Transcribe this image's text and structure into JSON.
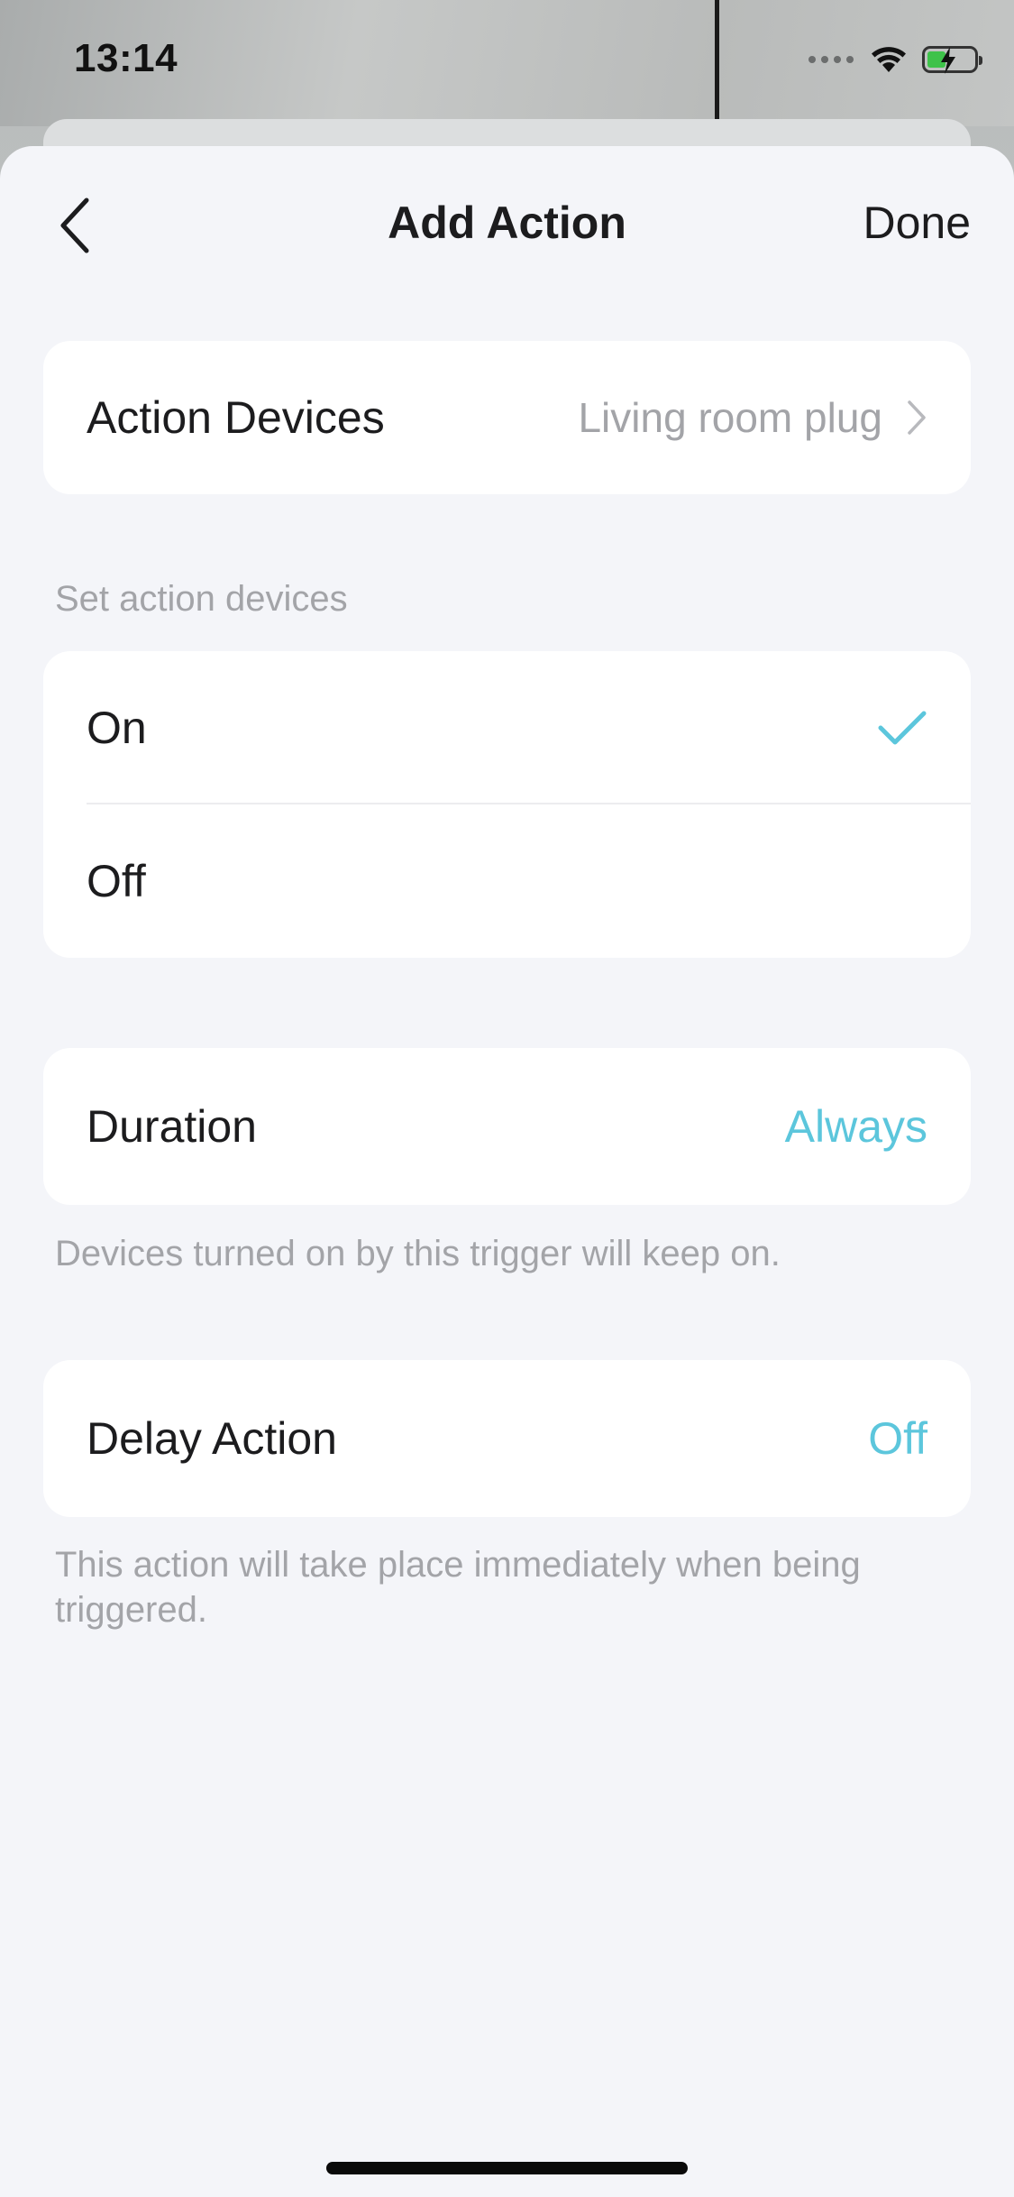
{
  "status_bar": {
    "time": "13:14",
    "icons": [
      "cellular-signal-icon",
      "wifi-icon",
      "battery-charging-icon"
    ]
  },
  "nav": {
    "title": "Add Action",
    "done_label": "Done",
    "back_icon": "chevron-left-icon"
  },
  "action_devices": {
    "label": "Action Devices",
    "value": "Living room plug"
  },
  "set_action": {
    "header": "Set action devices",
    "options": [
      {
        "label": "On",
        "selected": true
      },
      {
        "label": "Off",
        "selected": false
      }
    ]
  },
  "duration": {
    "label": "Duration",
    "value": "Always",
    "note": "Devices turned on by this trigger will keep on."
  },
  "delay": {
    "label": "Delay Action",
    "value": "Off",
    "note": "This action will take place immediately when being triggered."
  },
  "colors": {
    "accent": "#5cc6dc",
    "background": "#f4f5f9",
    "card": "#ffffff",
    "secondary_text": "#a3a4a8"
  }
}
